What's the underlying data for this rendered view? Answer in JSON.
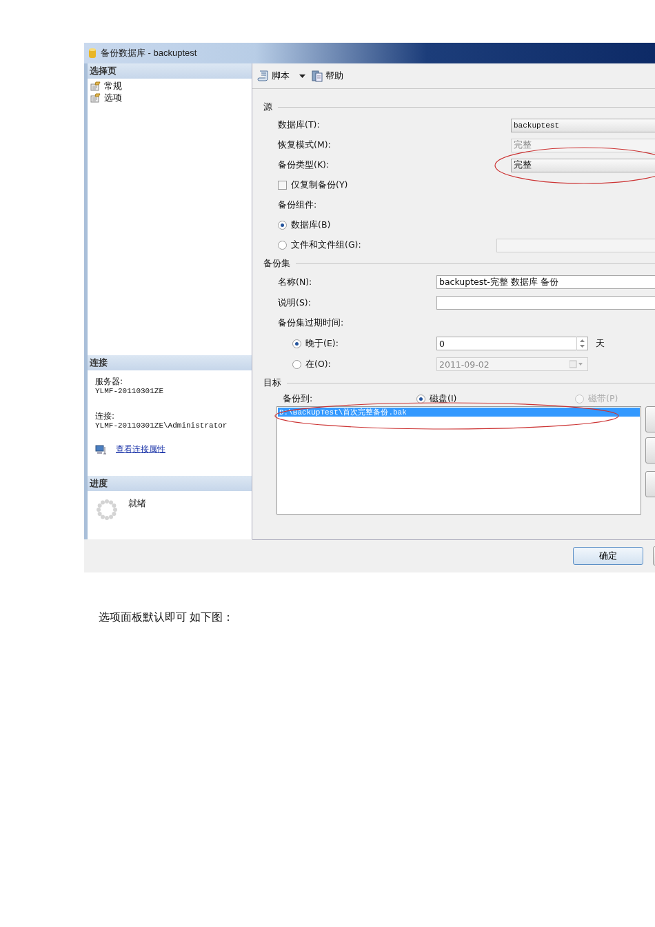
{
  "window": {
    "title": "备份数据库 - backuptest"
  },
  "sidebar": {
    "heading": "选择页",
    "pages": [
      {
        "label": "常规"
      },
      {
        "label": "选项"
      }
    ]
  },
  "connection": {
    "heading": "连接",
    "server_label": "服务器:",
    "server": "YLMF-20110301ZE",
    "connection_label": "连接:",
    "connection": "YLMF-20110301ZE\\Administrator",
    "link": "查看连接属性"
  },
  "progress": {
    "heading": "进度",
    "status": "就绪"
  },
  "toolbar": [
    {
      "label": "脚本",
      "kind": "script",
      "has_menu": true
    },
    {
      "label": "帮助",
      "kind": "help",
      "has_menu": false
    }
  ],
  "source": {
    "heading": "源",
    "fields": [
      {
        "label": "数据库(T):",
        "value": "backuptest",
        "kind": "combo",
        "disabled": false,
        "circled": false
      },
      {
        "label": "恢复模式(M):",
        "value": "完整",
        "kind": "text",
        "disabled": true,
        "circled": false
      },
      {
        "label": "备份类型(K):",
        "value": "完整",
        "kind": "combo",
        "disabled": false,
        "circled": true
      }
    ],
    "copy_only": {
      "label": "仅复制备份(Y)",
      "checked": false
    },
    "component_label": "备份组件:",
    "components": [
      {
        "label": "数据库(B)",
        "selected": true
      },
      {
        "label": "文件和文件组(G):",
        "selected": false
      }
    ]
  },
  "backup_set": {
    "heading": "备份集",
    "name_label": "名称(N):",
    "name": "backuptest-完整 数据库 备份",
    "description_label": "说明(S):",
    "expiry_label": "备份集过期时间:",
    "after": {
      "label": "晚于(E):",
      "value": "0",
      "unit": "天",
      "selected": true
    },
    "on": {
      "label": "在(O):",
      "value": "2011-09-02",
      "selected": false
    }
  },
  "destination": {
    "heading": "目标",
    "to_label": "备份到:",
    "circled": true,
    "media": [
      {
        "label": "磁盘(I)",
        "selected": true,
        "disabled": false
      },
      {
        "label": "磁带(P)",
        "selected": false,
        "disabled": true
      }
    ],
    "files": [
      {
        "path": "D:\\BackUpTest\\首次完整备份.bak",
        "selected": true
      }
    ]
  },
  "buttons": [
    {
      "label": "确定"
    }
  ],
  "caption": "选项面板默认即可 如下图："
}
